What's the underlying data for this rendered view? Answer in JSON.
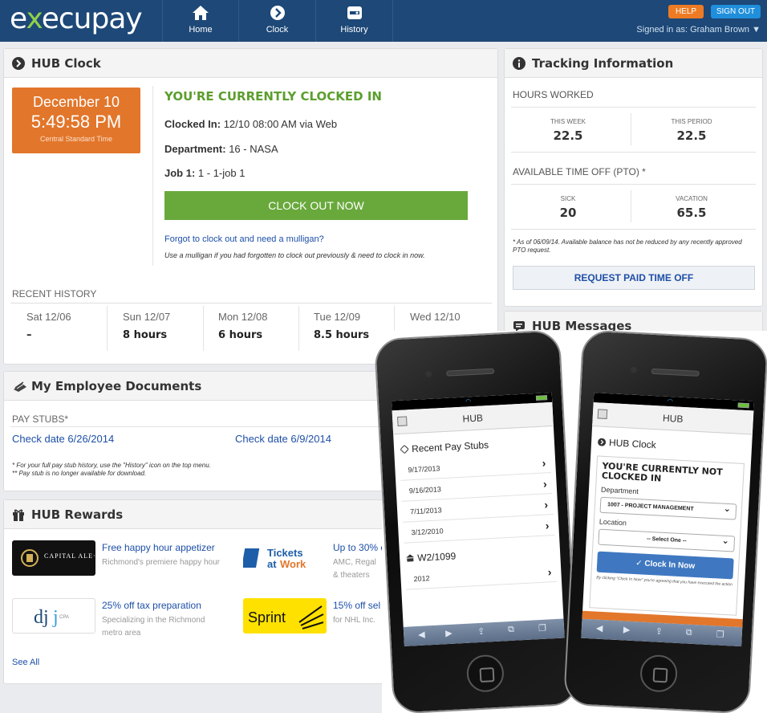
{
  "app": {
    "logo_prefix": "e",
    "logo_x": "x",
    "logo_suffix": "ecupay"
  },
  "nav": {
    "home": "Home",
    "clock": "Clock",
    "history": "History"
  },
  "header_buttons": {
    "help": "HELP",
    "sign_out": "SIGN OUT",
    "signed_in": "Signed in as: Graham Brown ▼"
  },
  "hub_clock": {
    "title": "HUB Clock",
    "date": "December 10",
    "time": "5:49:58 PM",
    "timezone": "Central Standard Time",
    "status": "YOU'RE CURRENTLY CLOCKED IN",
    "clocked_in_label": "Clocked In:",
    "clocked_in_value": "12/10 08:00 AM via Web",
    "department_label": "Department:",
    "department_value": "16 - NASA",
    "job_label": "Job 1:",
    "job_value": "1 - 1-job 1",
    "clock_out_button": "CLOCK OUT NOW",
    "mulligan_link": "Forgot to clock out and need a mulligan?",
    "mulligan_note": "Use a mulligan if you had forgotten to clock out previously & need to clock in now.",
    "recent_history_title": "RECENT HISTORY",
    "history": [
      {
        "day": "Sat 12/06",
        "hours": "–"
      },
      {
        "day": "Sun 12/07",
        "hours": "8 hours"
      },
      {
        "day": "Mon 12/08",
        "hours": "6 hours"
      },
      {
        "day": "Tue 12/09",
        "hours": "8.5 hours"
      },
      {
        "day": "Wed 12/10",
        "hours": ""
      }
    ]
  },
  "tracking": {
    "title": "Tracking Information",
    "hours_worked": "HOURS WORKED",
    "this_week_label": "THIS WEEK",
    "this_week_value": "22.5",
    "this_period_label": "THIS PERIOD",
    "this_period_value": "22.5",
    "pto_title": "AVAILABLE TIME OFF (PTO) *",
    "sick_label": "SICK",
    "sick_value": "20",
    "vacation_label": "VACATION",
    "vacation_value": "65.5",
    "note": "* As of 06/09/14. Available balance has not be reduced by any recently approved PTO request.",
    "request_button": "REQUEST PAID TIME OFF"
  },
  "messages": {
    "title": "HUB Messages"
  },
  "documents": {
    "title": "My Employee Documents",
    "subtitle": "PAY STUBS*",
    "links": [
      "Check date 6/26/2014",
      "Check date 6/9/2014"
    ],
    "note1": "* For your full pay stub history, use the \"History\" icon on the top menu.",
    "note2": "** Pay stub is no longer available for download."
  },
  "rewards": {
    "title": "HUB Rewards",
    "items": [
      {
        "logo": "CAPITAL ALE·HOUSE",
        "title": "Free happy hour appetizer",
        "desc": "Richmond's premiere happy hour"
      },
      {
        "logo": "Tickets at Work",
        "title": "Up to 30% o",
        "desc": "AMC, Regal & theaters"
      },
      {
        "logo": "djj CPA",
        "title": "25% off tax preparation",
        "desc": "Specializing in the Richmond metro area"
      },
      {
        "logo": "Sprint",
        "title": "15% off sel",
        "desc": "for NHL Inc."
      }
    ],
    "see_all": "See All"
  },
  "phone1": {
    "header": "HUB",
    "section1": "Recent Pay Stubs",
    "stubs": [
      "9/17/2013",
      "9/16/2013",
      "7/11/2013",
      "3/12/2010"
    ],
    "section2": "W2/1099",
    "w2": [
      "2012"
    ]
  },
  "phone2": {
    "header": "HUB",
    "section": "HUB Clock",
    "status": "YOU'RE CURRENTLY NOT CLOCKED IN",
    "department_label": "Department",
    "department_value": "1007 - PROJECT MANAGEMENT",
    "location_label": "Location",
    "location_value": "-- Select One --",
    "clock_in_button": "Clock In Now",
    "note": "By clicking \"Clock In Now\" you're agreeing that you have executed the action"
  },
  "colors": {
    "nav_blue": "#1d4877",
    "accent_orange": "#e2762b",
    "accent_green": "#69a93c",
    "link_blue": "#1d4fa8"
  }
}
